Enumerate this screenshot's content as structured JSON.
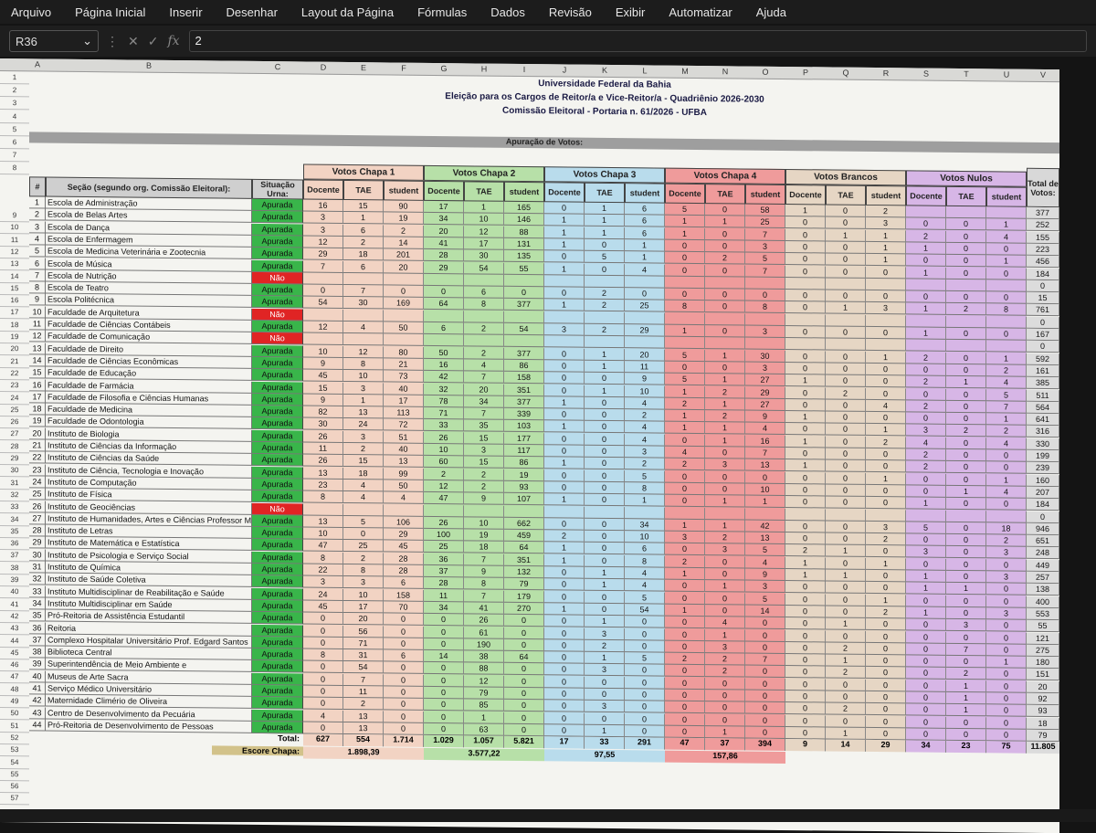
{
  "menu": [
    "Arquivo",
    "Página Inicial",
    "Inserir",
    "Desenhar",
    "Layout da Página",
    "Fórmulas",
    "Dados",
    "Revisão",
    "Exibir",
    "Automatizar",
    "Ajuda"
  ],
  "formula_bar": {
    "name_box": "R36",
    "value": "2"
  },
  "columns": [
    "A",
    "B",
    "C",
    "D",
    "E",
    "F",
    "G",
    "H",
    "I",
    "J",
    "K",
    "L",
    "M",
    "N",
    "O",
    "P",
    "Q",
    "R",
    "S",
    "T",
    "U",
    "V"
  ],
  "title": {
    "line1": "Universidade Federal da Bahia",
    "line2": "Eleição para os Cargos de Reitor/a e Vice-Reitor/a - Quadriênio 2026-2030",
    "line3": "Comissão Eleitoral - Portaria n. 61/2026 - UFBA"
  },
  "section_title": "Apuração de Votos:",
  "headers": {
    "num": "#",
    "secao": "Seção (segundo org. Comissão Eleitoral):",
    "situacao": "Situação Urna:",
    "total": "Total de Votos:",
    "groups": [
      "Votos Chapa 1",
      "Votos Chapa 2",
      "Votos Chapa 3",
      "Votos Chapa 4",
      "Votos Brancos",
      "Votos Nulos"
    ],
    "sub": [
      "Docente",
      "TAE",
      "student"
    ]
  },
  "group_colors": [
    "#f2d3c3",
    "#b7e0a8",
    "#b9dcec",
    "#ef9b9b",
    "#e6d6c4",
    "#d7b6e6"
  ],
  "rows": [
    {
      "n": "1",
      "s": "Escola de Administração",
      "u": "Apurada",
      "v": [
        "16",
        "15",
        "90",
        "17",
        "1",
        "165",
        "0",
        "1",
        "6",
        "5",
        "0",
        "58",
        "1",
        "0",
        "2",
        "",
        "",
        "",
        ""
      ],
      "t": "377"
    },
    {
      "n": "2",
      "s": "Escola de Belas Artes",
      "u": "Apurada",
      "v": [
        "3",
        "1",
        "19",
        "34",
        "10",
        "146",
        "1",
        "1",
        "6",
        "1",
        "1",
        "25",
        "0",
        "0",
        "3",
        "0",
        "0",
        "1"
      ],
      "t": "252"
    },
    {
      "n": "3",
      "s": "Escola de Dança",
      "u": "Apurada",
      "v": [
        "3",
        "6",
        "2",
        "20",
        "12",
        "88",
        "1",
        "1",
        "6",
        "1",
        "0",
        "7",
        "0",
        "1",
        "1",
        "2",
        "0",
        "4"
      ],
      "t": "155"
    },
    {
      "n": "4",
      "s": "Escola de Enfermagem",
      "u": "Apurada",
      "v": [
        "12",
        "2",
        "14",
        "41",
        "17",
        "131",
        "1",
        "0",
        "1",
        "0",
        "0",
        "3",
        "0",
        "0",
        "1",
        "1",
        "0",
        "0"
      ],
      "t": "223"
    },
    {
      "n": "5",
      "s": "Escola de Medicina Veterinária e Zootecnia",
      "u": "Apurada",
      "v": [
        "29",
        "18",
        "201",
        "28",
        "30",
        "135",
        "0",
        "5",
        "1",
        "0",
        "2",
        "5",
        "0",
        "0",
        "1",
        "0",
        "0",
        "1"
      ],
      "t": "456"
    },
    {
      "n": "6",
      "s": "Escola de Música",
      "u": "Apurada",
      "v": [
        "7",
        "6",
        "20",
        "29",
        "54",
        "55",
        "1",
        "0",
        "4",
        "0",
        "0",
        "7",
        "0",
        "0",
        "0",
        "1",
        "0",
        "0"
      ],
      "t": "184"
    },
    {
      "n": "7",
      "s": "Escola de Nutrição",
      "u": "Não",
      "v": [
        "",
        "",
        "",
        "",
        "",
        "",
        "",
        "",
        "",
        "",
        "",
        "",
        "",
        "",
        "",
        "",
        "",
        ""
      ],
      "t": "0"
    },
    {
      "n": "8",
      "s": "Escola de Teatro",
      "u": "Apurada",
      "v": [
        "0",
        "7",
        "0",
        "0",
        "6",
        "0",
        "0",
        "2",
        "0",
        "0",
        "0",
        "0",
        "0",
        "0",
        "0",
        "0",
        "0",
        "0"
      ],
      "t": "15"
    },
    {
      "n": "9",
      "s": "Escola Politécnica",
      "u": "Apurada",
      "v": [
        "54",
        "30",
        "169",
        "64",
        "8",
        "377",
        "1",
        "2",
        "25",
        "8",
        "0",
        "8",
        "0",
        "1",
        "3",
        "1",
        "2",
        "8"
      ],
      "t": "761"
    },
    {
      "n": "10",
      "s": "Faculdade de Arquitetura",
      "u": "Não",
      "v": [
        "",
        "",
        "",
        "",
        "",
        "",
        "",
        "",
        "",
        "",
        "",
        "",
        "",
        "",
        "",
        "",
        "",
        ""
      ],
      "t": "0"
    },
    {
      "n": "11",
      "s": "Faculdade de Ciências Contábeis",
      "u": "Apurada",
      "v": [
        "12",
        "4",
        "50",
        "6",
        "2",
        "54",
        "3",
        "2",
        "29",
        "1",
        "0",
        "3",
        "0",
        "0",
        "0",
        "1",
        "0",
        "0"
      ],
      "t": "167"
    },
    {
      "n": "12",
      "s": "Faculdade de Comunicação",
      "u": "Não",
      "v": [
        "",
        "",
        "",
        "",
        "",
        "",
        "",
        "",
        "",
        "",
        "",
        "",
        "",
        "",
        "",
        "",
        "",
        ""
      ],
      "t": "0"
    },
    {
      "n": "13",
      "s": "Faculdade de Direito",
      "u": "Apurada",
      "v": [
        "10",
        "12",
        "80",
        "50",
        "2",
        "377",
        "0",
        "1",
        "20",
        "5",
        "1",
        "30",
        "0",
        "0",
        "1",
        "2",
        "0",
        "1"
      ],
      "t": "592"
    },
    {
      "n": "14",
      "s": "Faculdade de Ciências Econômicas",
      "u": "Apurada",
      "v": [
        "9",
        "8",
        "21",
        "16",
        "4",
        "86",
        "0",
        "1",
        "11",
        "0",
        "0",
        "3",
        "0",
        "0",
        "0",
        "0",
        "0",
        "2"
      ],
      "t": "161"
    },
    {
      "n": "15",
      "s": "Faculdade de Educação",
      "u": "Apurada",
      "v": [
        "45",
        "10",
        "73",
        "42",
        "7",
        "158",
        "0",
        "0",
        "9",
        "5",
        "1",
        "27",
        "1",
        "0",
        "0",
        "2",
        "1",
        "4"
      ],
      "t": "385"
    },
    {
      "n": "16",
      "s": "Faculdade de Farmácia",
      "u": "Apurada",
      "v": [
        "15",
        "3",
        "40",
        "32",
        "20",
        "351",
        "0",
        "1",
        "10",
        "1",
        "2",
        "29",
        "0",
        "2",
        "0",
        "0",
        "0",
        "5"
      ],
      "t": "511"
    },
    {
      "n": "17",
      "s": "Faculdade de Filosofia e Ciências Humanas",
      "u": "Apurada",
      "v": [
        "9",
        "1",
        "17",
        "78",
        "34",
        "377",
        "1",
        "0",
        "4",
        "2",
        "1",
        "27",
        "0",
        "0",
        "4",
        "2",
        "0",
        "7"
      ],
      "t": "564"
    },
    {
      "n": "18",
      "s": "Faculdade de Medicina",
      "u": "Apurada",
      "v": [
        "82",
        "13",
        "113",
        "71",
        "7",
        "339",
        "0",
        "0",
        "2",
        "1",
        "2",
        "9",
        "1",
        "0",
        "0",
        "0",
        "0",
        "1"
      ],
      "t": "641"
    },
    {
      "n": "19",
      "s": "Faculdade de Odontologia",
      "u": "Apurada",
      "v": [
        "30",
        "24",
        "72",
        "33",
        "35",
        "103",
        "1",
        "0",
        "4",
        "1",
        "1",
        "4",
        "0",
        "0",
        "1",
        "3",
        "2",
        "2"
      ],
      "t": "316"
    },
    {
      "n": "20",
      "s": "Instituto de Biologia",
      "u": "Apurada",
      "v": [
        "26",
        "3",
        "51",
        "26",
        "15",
        "177",
        "0",
        "0",
        "4",
        "0",
        "1",
        "16",
        "1",
        "0",
        "2",
        "4",
        "0",
        "4"
      ],
      "t": "330"
    },
    {
      "n": "21",
      "s": "Instituto de Ciências da Informação",
      "u": "Apurada",
      "v": [
        "11",
        "2",
        "40",
        "10",
        "3",
        "117",
        "0",
        "0",
        "3",
        "4",
        "0",
        "7",
        "0",
        "0",
        "0",
        "2",
        "0",
        "0"
      ],
      "t": "199"
    },
    {
      "n": "22",
      "s": "Instituto de Ciências da Saúde",
      "u": "Apurada",
      "v": [
        "26",
        "15",
        "13",
        "60",
        "15",
        "86",
        "1",
        "0",
        "2",
        "2",
        "3",
        "13",
        "1",
        "0",
        "0",
        "2",
        "0",
        "0"
      ],
      "t": "239"
    },
    {
      "n": "23",
      "s": "Instituto de Ciência, Tecnologia e Inovação",
      "u": "Apurada",
      "v": [
        "13",
        "18",
        "99",
        "2",
        "2",
        "19",
        "0",
        "0",
        "5",
        "0",
        "0",
        "0",
        "0",
        "0",
        "1",
        "0",
        "0",
        "1"
      ],
      "t": "160"
    },
    {
      "n": "24",
      "s": "Instituto de Computação",
      "u": "Apurada",
      "v": [
        "23",
        "4",
        "50",
        "12",
        "2",
        "93",
        "0",
        "0",
        "8",
        "0",
        "0",
        "10",
        "0",
        "0",
        "0",
        "0",
        "1",
        "4"
      ],
      "t": "207"
    },
    {
      "n": "25",
      "s": "Instituto de Física",
      "u": "Apurada",
      "v": [
        "8",
        "4",
        "4",
        "47",
        "9",
        "107",
        "1",
        "0",
        "1",
        "0",
        "1",
        "1",
        "0",
        "0",
        "0",
        "1",
        "0",
        "0"
      ],
      "t": "184"
    },
    {
      "n": "26",
      "s": "Instituto de Geociências",
      "u": "Não",
      "v": [
        "",
        "",
        "",
        "",
        "",
        "",
        "",
        "",
        "",
        "",
        "",
        "",
        "",
        "",
        "",
        "",
        "",
        ""
      ],
      "t": "0"
    },
    {
      "n": "27",
      "s": "Instituto de Humanidades, Artes e Ciências Professor Milton Santos",
      "u": "Apurada",
      "v": [
        "13",
        "5",
        "106",
        "26",
        "10",
        "662",
        "0",
        "0",
        "34",
        "1",
        "1",
        "42",
        "0",
        "0",
        "3",
        "5",
        "0",
        "18"
      ],
      "t": "946"
    },
    {
      "n": "28",
      "s": "Instituto de Letras",
      "u": "Apurada",
      "v": [
        "10",
        "0",
        "29",
        "100",
        "19",
        "459",
        "2",
        "0",
        "10",
        "3",
        "2",
        "13",
        "0",
        "0",
        "2",
        "0",
        "0",
        "2"
      ],
      "t": "651"
    },
    {
      "n": "29",
      "s": "Instituto de Matemática e Estatística",
      "u": "Apurada",
      "v": [
        "47",
        "25",
        "45",
        "25",
        "18",
        "64",
        "1",
        "0",
        "6",
        "0",
        "3",
        "5",
        "2",
        "1",
        "0",
        "3",
        "0",
        "3"
      ],
      "t": "248"
    },
    {
      "n": "30",
      "s": "Instituto de Psicologia e Serviço Social",
      "u": "Apurada",
      "v": [
        "8",
        "2",
        "28",
        "36",
        "7",
        "351",
        "1",
        "0",
        "8",
        "2",
        "0",
        "4",
        "1",
        "0",
        "1",
        "0",
        "0",
        "0"
      ],
      "t": "449"
    },
    {
      "n": "31",
      "s": "Instituto de Química",
      "u": "Apurada",
      "v": [
        "22",
        "8",
        "28",
        "37",
        "9",
        "132",
        "0",
        "1",
        "4",
        "1",
        "0",
        "9",
        "1",
        "1",
        "0",
        "1",
        "0",
        "3"
      ],
      "t": "257"
    },
    {
      "n": "32",
      "s": "Instituto de Saúde Coletiva",
      "u": "Apurada",
      "v": [
        "3",
        "3",
        "6",
        "28",
        "8",
        "79",
        "0",
        "1",
        "4",
        "0",
        "1",
        "3",
        "0",
        "0",
        "0",
        "1",
        "1",
        "0"
      ],
      "t": "138"
    },
    {
      "n": "33",
      "s": "Instituto Multidisciplinar de Reabilitação e Saúde",
      "u": "Apurada",
      "v": [
        "24",
        "10",
        "158",
        "11",
        "7",
        "179",
        "0",
        "0",
        "5",
        "0",
        "0",
        "5",
        "0",
        "0",
        "1",
        "0",
        "0",
        "0"
      ],
      "t": "400"
    },
    {
      "n": "34",
      "s": "Instituto Multidisciplinar em Saúde",
      "u": "Apurada",
      "v": [
        "45",
        "17",
        "70",
        "34",
        "41",
        "270",
        "1",
        "0",
        "54",
        "1",
        "0",
        "14",
        "0",
        "0",
        "2",
        "1",
        "0",
        "3"
      ],
      "t": "553"
    },
    {
      "n": "35",
      "s": "Pró-Reitoria de Assistência Estudantil",
      "u": "Apurada",
      "v": [
        "0",
        "20",
        "0",
        "0",
        "26",
        "0",
        "0",
        "1",
        "0",
        "0",
        "4",
        "0",
        "0",
        "1",
        "0",
        "0",
        "3",
        "0"
      ],
      "t": "55"
    },
    {
      "n": "36",
      "s": "Reitoria",
      "u": "Apurada",
      "v": [
        "0",
        "56",
        "0",
        "0",
        "61",
        "0",
        "0",
        "3",
        "0",
        "0",
        "1",
        "0",
        "0",
        "0",
        "0",
        "0",
        "0",
        "0"
      ],
      "t": "121"
    },
    {
      "n": "37",
      "s": "Complexo Hospitalar Universitário Prof. Edgard Santos",
      "u": "Apurada",
      "v": [
        "0",
        "71",
        "0",
        "0",
        "190",
        "0",
        "0",
        "2",
        "0",
        "0",
        "3",
        "0",
        "0",
        "2",
        "0",
        "0",
        "7",
        "0"
      ],
      "t": "275"
    },
    {
      "n": "38",
      "s": "Biblioteca Central",
      "u": "Apurada",
      "v": [
        "8",
        "31",
        "6",
        "14",
        "38",
        "64",
        "0",
        "1",
        "5",
        "2",
        "2",
        "7",
        "0",
        "1",
        "0",
        "0",
        "0",
        "1"
      ],
      "t": "180"
    },
    {
      "n": "39",
      "s": "Superintendência de Meio Ambiente e",
      "u": "Apurada",
      "v": [
        "0",
        "54",
        "0",
        "0",
        "88",
        "0",
        "0",
        "3",
        "0",
        "0",
        "2",
        "0",
        "0",
        "2",
        "0",
        "0",
        "2",
        "0"
      ],
      "t": "151"
    },
    {
      "n": "40",
      "s": "Museus de Arte Sacra",
      "u": "Apurada",
      "v": [
        "0",
        "7",
        "0",
        "0",
        "12",
        "0",
        "0",
        "0",
        "0",
        "0",
        "0",
        "0",
        "0",
        "0",
        "0",
        "0",
        "1",
        "0"
      ],
      "t": "20"
    },
    {
      "n": "41",
      "s": "Serviço Médico Universitário",
      "u": "Apurada",
      "v": [
        "0",
        "11",
        "0",
        "0",
        "79",
        "0",
        "0",
        "0",
        "0",
        "0",
        "0",
        "0",
        "0",
        "0",
        "0",
        "0",
        "1",
        "0"
      ],
      "t": "92"
    },
    {
      "n": "42",
      "s": "Maternidade Climério de Oliveira",
      "u": "Apurada",
      "v": [
        "0",
        "2",
        "0",
        "0",
        "85",
        "0",
        "0",
        "3",
        "0",
        "0",
        "0",
        "0",
        "0",
        "2",
        "0",
        "0",
        "1",
        "0"
      ],
      "t": "93"
    },
    {
      "n": "43",
      "s": "Centro de Desenvolvimento da Pecuária",
      "u": "Apurada",
      "v": [
        "4",
        "13",
        "0",
        "0",
        "1",
        "0",
        "0",
        "0",
        "0",
        "0",
        "0",
        "0",
        "0",
        "0",
        "0",
        "0",
        "0",
        "0"
      ],
      "t": "18"
    },
    {
      "n": "44",
      "s": "Pró-Reitoria de Desenvolvimento de Pessoas",
      "u": "Apurada",
      "v": [
        "0",
        "13",
        "0",
        "0",
        "63",
        "0",
        "0",
        "1",
        "0",
        "0",
        "1",
        "0",
        "0",
        "1",
        "0",
        "0",
        "0",
        "0"
      ],
      "t": "79"
    }
  ],
  "totals": {
    "label": "Total:",
    "values": [
      "627",
      "554",
      "1.714",
      "1.029",
      "1.057",
      "5.821",
      "17",
      "33",
      "291",
      "47",
      "37",
      "394",
      "9",
      "14",
      "29",
      "34",
      "23",
      "75"
    ],
    "grand": "11.805"
  },
  "escore": {
    "label": "Escore Chapa:",
    "values": [
      "1.898,39",
      "3.577,22",
      "97,55",
      "157,86"
    ]
  }
}
